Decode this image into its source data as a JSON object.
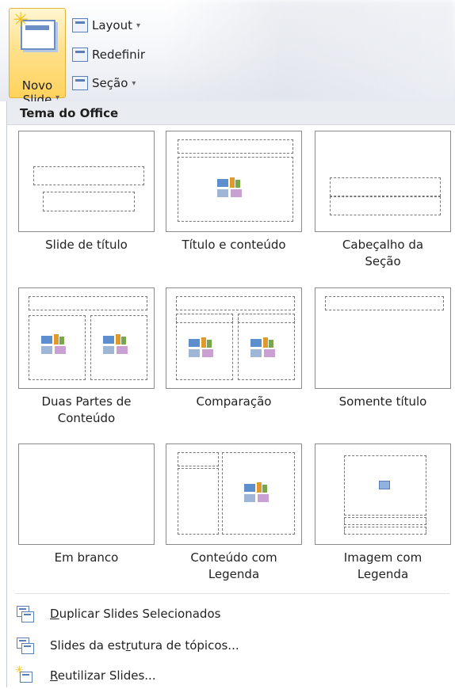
{
  "ribbon": {
    "novo_slide_label": "Novo\nSlide",
    "novo_slide_caret": "▾",
    "layout_label": "Layout",
    "redefinir_label": "Redefinir",
    "secao_label": "Seção",
    "caret": "▾"
  },
  "gallery": {
    "heading": "Tema do Office",
    "layouts": [
      {
        "name": "Slide de título"
      },
      {
        "name": "Título e conteúdo"
      },
      {
        "name": "Cabeçalho da\nSeção"
      },
      {
        "name": "Duas Partes de\nConteúdo"
      },
      {
        "name": "Comparação"
      },
      {
        "name": "Somente título"
      },
      {
        "name": "Em branco"
      },
      {
        "name": "Conteúdo com\nLegenda"
      },
      {
        "name": "Imagem com\nLegenda"
      }
    ]
  },
  "menu": {
    "items": [
      {
        "access_key": "D",
        "rest": "uplicar Slides Selecionados"
      },
      {
        "pre": "Slides da est",
        "access_key": "r",
        "rest": "utura de tópicos..."
      },
      {
        "access_key": "R",
        "rest": "eutilizar Slides..."
      }
    ]
  }
}
